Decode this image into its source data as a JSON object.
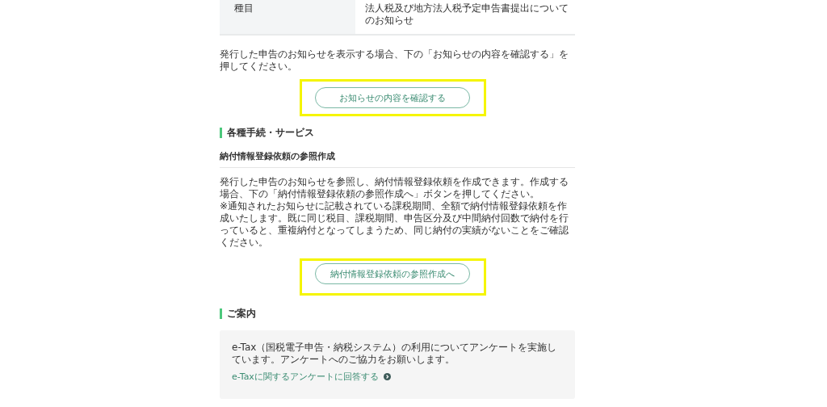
{
  "info_table": {
    "rows": [
      {
        "label": "種目",
        "value": "法人税及び地方法人税予定申告書提出についてのお知らせ"
      }
    ]
  },
  "notice_text": "発行した申告のお知らせを表示する場合、下の「お知らせの内容を確認する」を押してください。",
  "notice_button": {
    "label": "お知らせの内容を確認する",
    "highlighted": true
  },
  "section_heading": "各種手続・サービス",
  "subsection_heading": "納付情報登録依頼の参照作成",
  "subsection_text": [
    "発行した申告のお知らせを参照し、納付情報登録依頼を作成できます。作成する場合、下の「納付情報登録依頼の参照作成へ」ボタンを押してください。",
    "※通知されたお知らせに記載されている課税期間、全額で納付情報登録依頼を作成いたします。既に同じ税目、課税期間、申告区分及び中間納付回数で納付を行っていると、重複納付となってしまうため、同じ納付の実績がないことをご確認ください。"
  ],
  "subsection_button": {
    "label": "納付情報登録依頼の参照作成へ",
    "highlighted": true
  },
  "guide_heading": "ご案内",
  "guide_box": {
    "text": "e-Tax（国税電子申告・納税システム）の利用についてアンケートを実施しています。アンケートへのご協力をお願いします。",
    "link": "e-Taxに関するアンケートに回答する"
  }
}
